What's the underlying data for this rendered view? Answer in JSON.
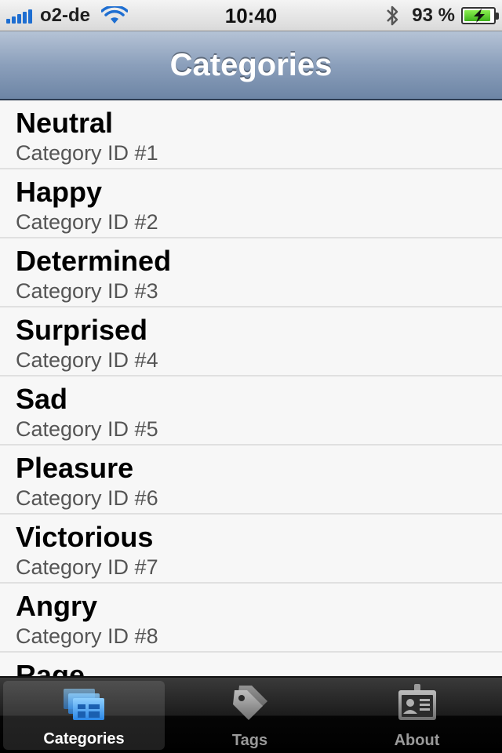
{
  "status_bar": {
    "carrier": "o2-de",
    "time": "10:40",
    "battery_percent": "93 %",
    "battery_level": 0.93
  },
  "nav": {
    "title": "Categories"
  },
  "list": {
    "items": [
      {
        "title": "Neutral",
        "subtitle": "Category ID #1"
      },
      {
        "title": "Happy",
        "subtitle": "Category ID #2"
      },
      {
        "title": "Determined",
        "subtitle": "Category ID #3"
      },
      {
        "title": "Surprised",
        "subtitle": "Category ID #4"
      },
      {
        "title": "Sad",
        "subtitle": "Category ID #5"
      },
      {
        "title": "Pleasure",
        "subtitle": "Category ID #6"
      },
      {
        "title": "Victorious",
        "subtitle": "Category ID #7"
      },
      {
        "title": "Angry",
        "subtitle": "Category ID #8"
      },
      {
        "title": "Rage",
        "subtitle": ""
      }
    ]
  },
  "tab_bar": {
    "tabs": [
      {
        "label": "Categories",
        "icon": "categories-icon",
        "selected": true
      },
      {
        "label": "Tags",
        "icon": "tag-icon",
        "selected": false
      },
      {
        "label": "About",
        "icon": "id-card-icon",
        "selected": false
      }
    ]
  },
  "colors": {
    "nav_gradient_top": "#b5c3d6",
    "nav_gradient_bottom": "#6d85a5",
    "tab_selected_icon": "#3c9bf0",
    "signal": "#1e6ed1",
    "battery_fill": "#3db11a"
  }
}
